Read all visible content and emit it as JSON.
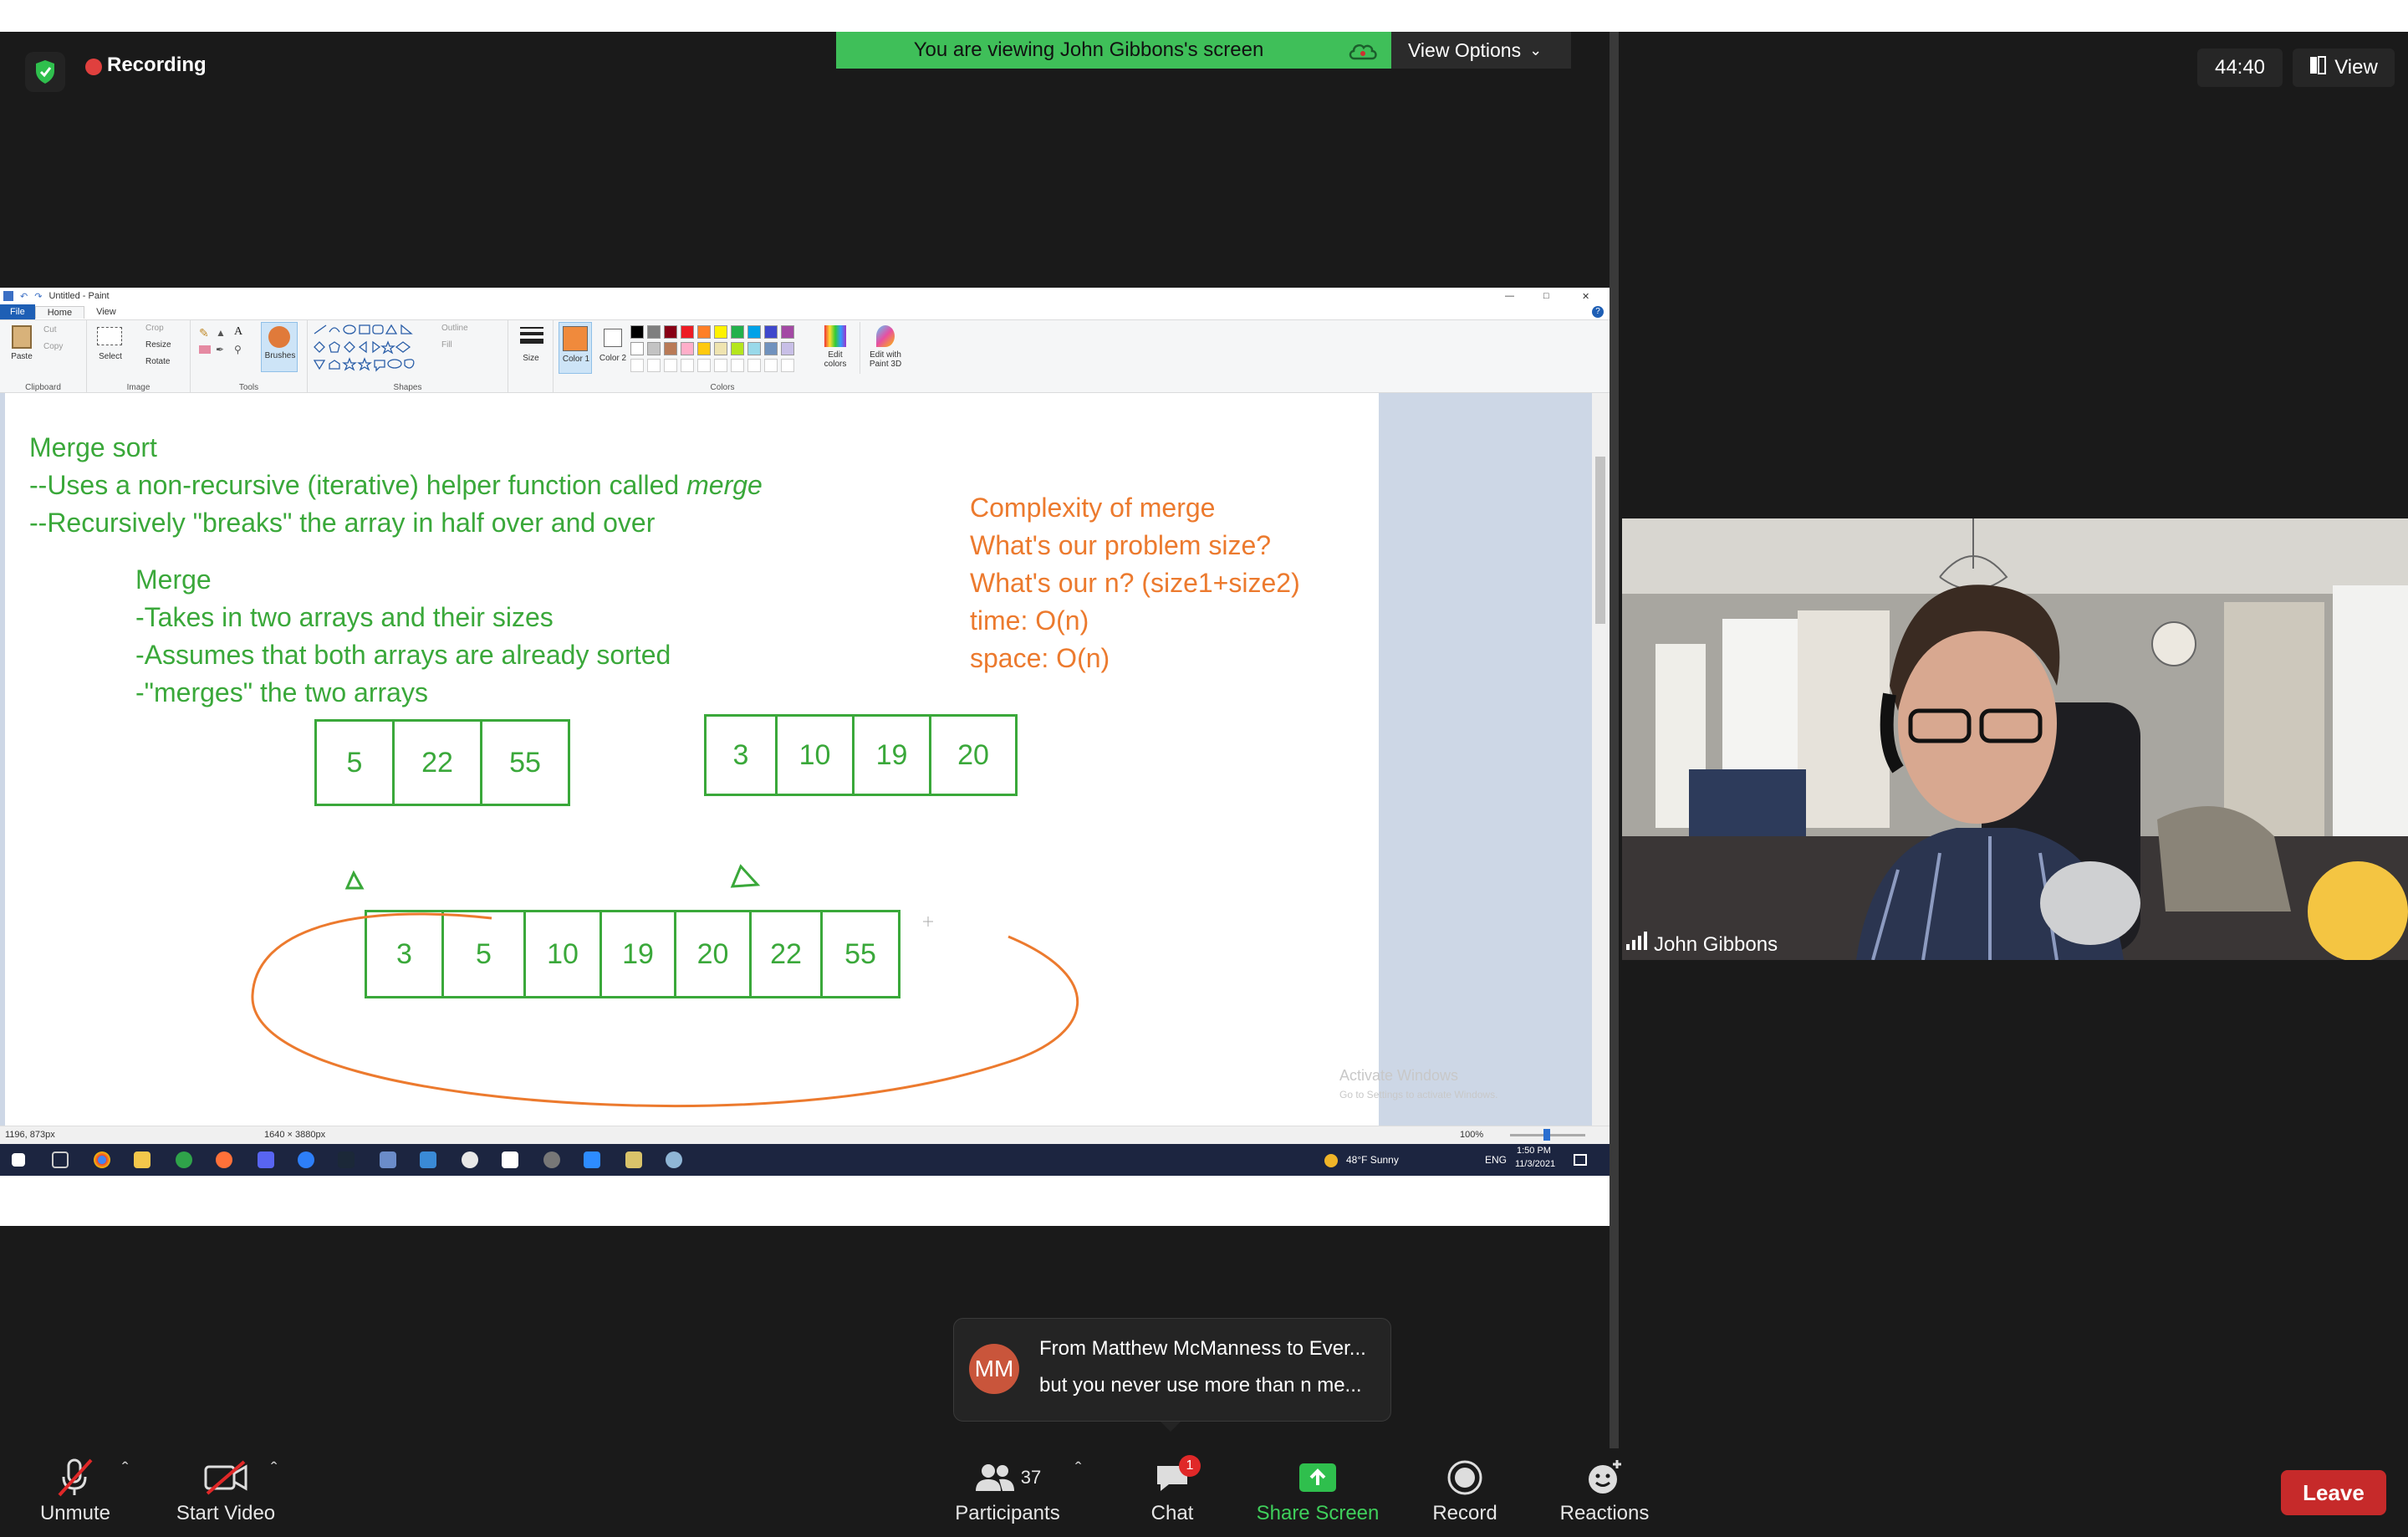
{
  "top_bar": {
    "recording_label": "Recording",
    "viewing_banner": "You are viewing John Gibbons's screen",
    "view_options_label": "View Options",
    "timer": "44:40",
    "view_label": "View"
  },
  "paint": {
    "window_title": "Untitled - Paint",
    "tabs": [
      "File",
      "Home",
      "View"
    ],
    "ribbon": {
      "clipboard": {
        "paste": "Paste",
        "cut": "Cut",
        "copy": "Copy",
        "group": "Clipboard"
      },
      "image": {
        "select": "Select",
        "crop": "Crop",
        "resize": "Resize",
        "rotate": "Rotate",
        "group": "Image"
      },
      "tools": {
        "brushes": "Brushes",
        "group": "Tools"
      },
      "shapes": {
        "outline": "Outline",
        "fill": "Fill",
        "group": "Shapes"
      },
      "size": "Size",
      "color1": "Color 1",
      "color2": "Color 2",
      "colors_group": "Colors",
      "edit_colors": "Edit colors",
      "edit_paint3d": "Edit with Paint 3D"
    },
    "palette": [
      "#000000",
      "#7f7f7f",
      "#880015",
      "#ed1c24",
      "#ff7f27",
      "#fff200",
      "#22b14c",
      "#00a2e8",
      "#3f48cc",
      "#a349a4",
      "#ffffff",
      "#c3c3c3",
      "#b97a57",
      "#ffaec9",
      "#ffc90e",
      "#efe4b0",
      "#b5e61d",
      "#99d9ea",
      "#7092be",
      "#c8bfe7"
    ],
    "canvas": {
      "green_notes": [
        "Merge sort",
        "--Uses a non-recursive (iterative) helper function called ",
        "--Recursively \"breaks\" the array in half over and over"
      ],
      "merge_word": "merge",
      "merge_notes": [
        "Merge",
        "-Takes in two arrays and their sizes",
        "-Assumes that both arrays are already sorted",
        "-\"merges\" the two arrays"
      ],
      "orange_notes": [
        "Complexity of merge",
        "What's our problem size?",
        "What's our n? (size1+size2)",
        "time: O(n)",
        "space:  O(n)"
      ],
      "array_a": [
        "5",
        "22",
        "55"
      ],
      "array_b": [
        "3",
        "10",
        "19",
        "20"
      ],
      "array_merged": [
        "3",
        "5",
        "10",
        "19",
        "20",
        "22",
        "55"
      ],
      "watermark_line1": "Activate Windows",
      "watermark_line2": "Go to Settings to activate Windows."
    },
    "status": {
      "cursor": "1196, 873px",
      "dimensions": "1640 × 3880px",
      "zoom": "100%"
    },
    "taskbar": {
      "weather": "48°F  Sunny",
      "lang": "ENG",
      "time": "1:50 PM",
      "date": "11/3/2021"
    }
  },
  "video": {
    "participant_name": "John Gibbons"
  },
  "chat_toast": {
    "initials": "MM",
    "line1": "From Matthew McManness to Ever...",
    "line2": "but you never use more than n me..."
  },
  "toolbar": {
    "unmute": "Unmute",
    "start_video": "Start Video",
    "participants": "Participants",
    "participants_count": "37",
    "chat": "Chat",
    "chat_badge": "1",
    "share_screen": "Share Screen",
    "record": "Record",
    "reactions": "Reactions",
    "leave": "Leave"
  }
}
